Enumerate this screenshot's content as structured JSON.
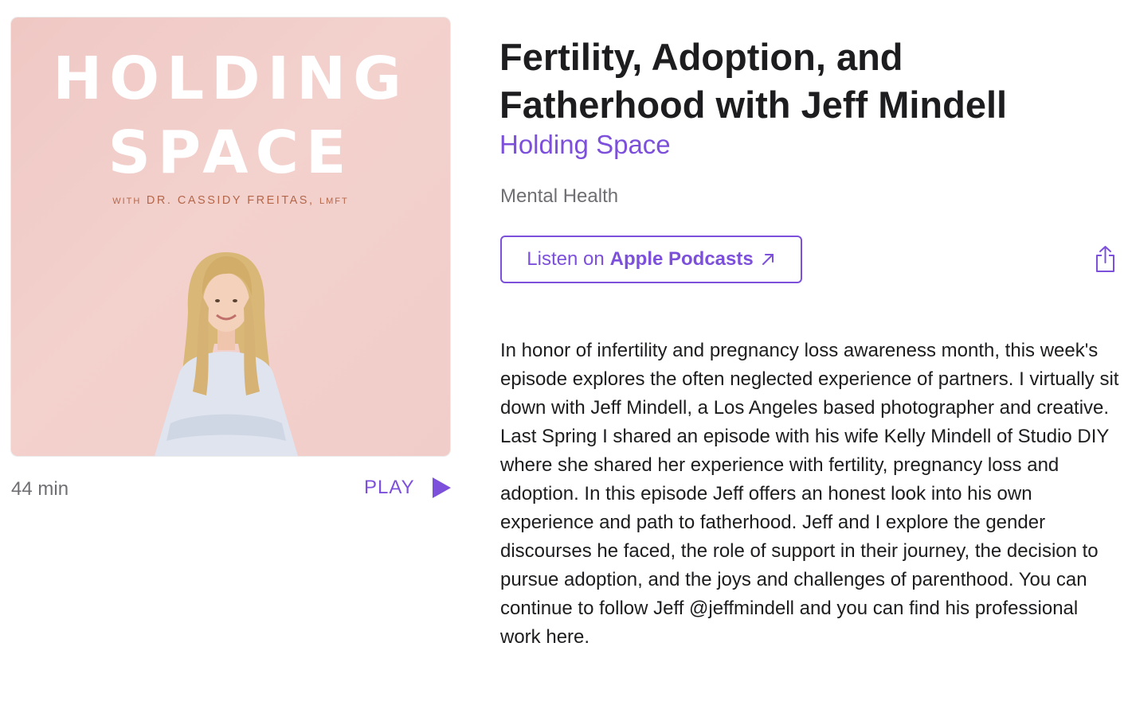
{
  "artwork": {
    "title_line1": "HOLDING",
    "title_line2": "SPACE",
    "sub_with": "WITH",
    "sub_name": "DR. CASSIDY FREITAS,",
    "sub_cred": "LMFT"
  },
  "episode": {
    "duration": "44 min",
    "play_label": "PLAY",
    "title": "Fertility, Adoption, and Fatherhood with Jeff Mindell",
    "show_name": "Holding Space",
    "category": "Mental Health",
    "listen_prefix": "Listen on",
    "listen_brand": "Apple Podcasts",
    "description": "In honor of infertility and pregnancy loss awareness month, this week's episode explores the often neglected experience of partners. I virtually sit down with Jeff Mindell, a Los Angeles based photographer and creative. Last Spring I shared an episode with his wife Kelly Mindell of Studio DIY where she shared her experience with fertility, pregnancy loss and adoption. In this episode Jeff offers an honest look into his own experience and path to fatherhood. Jeff and I explore the gender discourses he faced, the role of support in their journey, the decision to pursue adoption, and the joys and challenges of parenthood. You can continue to follow Jeff @jeffmindell and you can find his professional work here."
  },
  "icons": {
    "play": "play-icon",
    "external_link": "arrow-up-right-icon",
    "share": "share-icon"
  },
  "colors": {
    "accent": "#7d50dc",
    "secondary_text": "#6e6e73",
    "artwork_background": "#f1cdc9",
    "artwork_subtitle": "#b4674a"
  }
}
